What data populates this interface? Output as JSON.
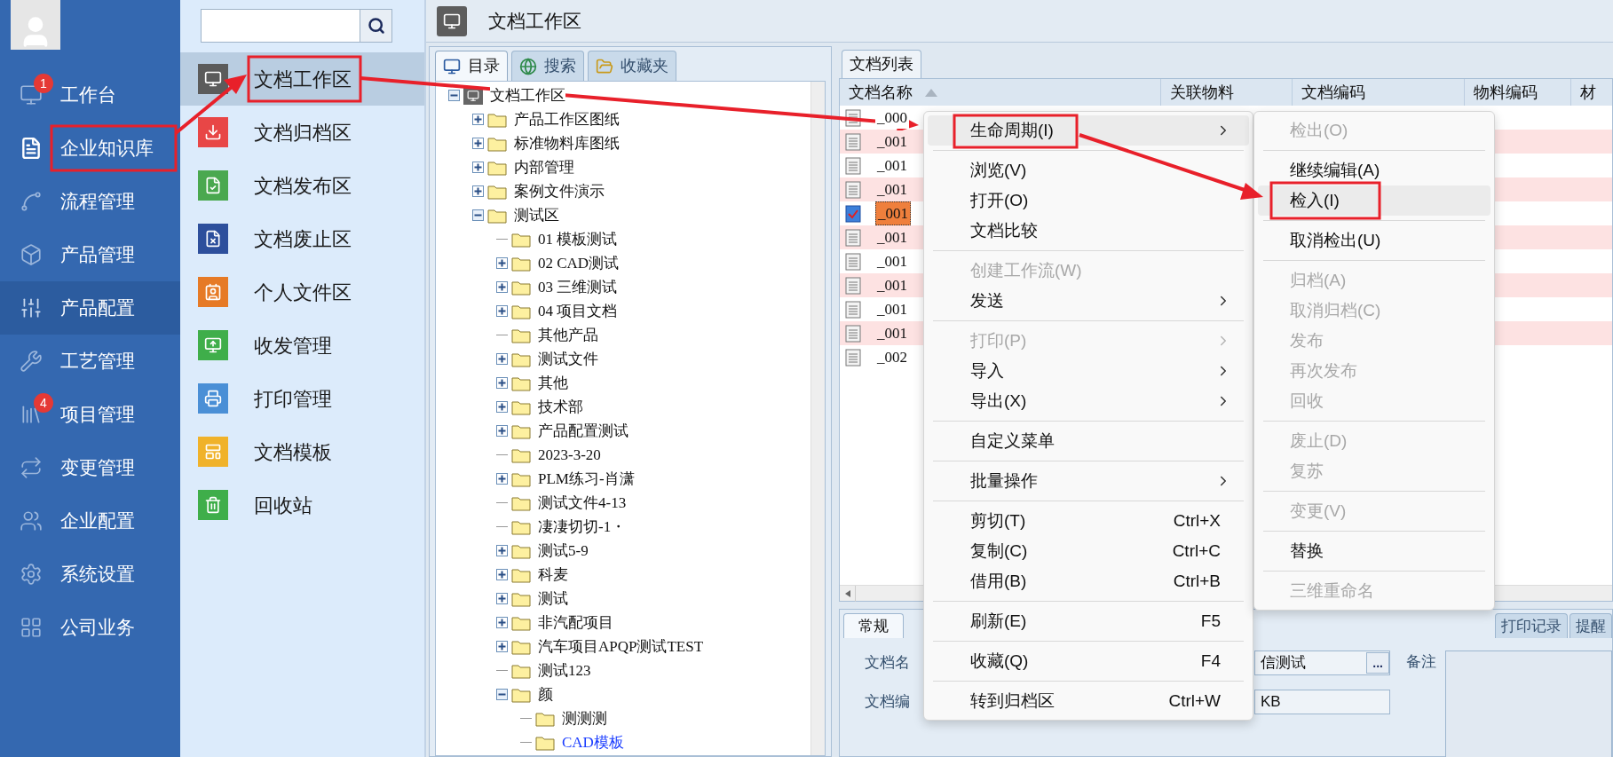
{
  "nav": {
    "items": [
      {
        "label": "工作台",
        "badge": "1",
        "selected": false,
        "hovered": false
      },
      {
        "label": "企业知识库",
        "selected": true,
        "hovered": false
      },
      {
        "label": "流程管理",
        "selected": false,
        "hovered": false
      },
      {
        "label": "产品管理",
        "selected": false,
        "hovered": false
      },
      {
        "label": "产品配置",
        "selected": false,
        "hovered": true
      },
      {
        "label": "工艺管理",
        "selected": false,
        "hovered": false
      },
      {
        "label": "项目管理",
        "badge": "4",
        "selected": false,
        "hovered": false
      },
      {
        "label": "变更管理",
        "selected": false,
        "hovered": false
      },
      {
        "label": "企业配置",
        "selected": false,
        "hovered": false
      },
      {
        "label": "系统设置",
        "selected": false,
        "hovered": false
      },
      {
        "label": "公司业务",
        "selected": false,
        "hovered": false
      }
    ]
  },
  "modules": {
    "items": [
      {
        "label": "文档工作区",
        "selected": true
      },
      {
        "label": "文档归档区",
        "selected": false
      },
      {
        "label": "文档发布区",
        "selected": false
      },
      {
        "label": "文档废止区",
        "selected": false
      },
      {
        "label": "个人文件区",
        "selected": false
      },
      {
        "label": "收发管理",
        "selected": false
      },
      {
        "label": "打印管理",
        "selected": false
      },
      {
        "label": "文档模板",
        "selected": false
      },
      {
        "label": "回收站",
        "selected": false
      }
    ]
  },
  "header": {
    "title": "文档工作区"
  },
  "tree_tabs": [
    {
      "label": "目录",
      "selected": true
    },
    {
      "label": "搜索",
      "selected": false
    },
    {
      "label": "收藏夹",
      "selected": false
    }
  ],
  "tree": {
    "label": "文档工作区",
    "expandable": true,
    "expanded": true,
    "selected": false,
    "children": [
      {
        "label": "产品工作区图纸",
        "expandable": true,
        "expanded": false,
        "selected": false
      },
      {
        "label": "标准物料库图纸",
        "expandable": true,
        "expanded": false,
        "selected": false
      },
      {
        "label": "内部管理",
        "expandable": true,
        "expanded": false,
        "selected": false
      },
      {
        "label": "案例文件演示",
        "expandable": true,
        "expanded": false,
        "selected": false
      },
      {
        "label": "测试区",
        "expandable": true,
        "expanded": true,
        "selected": false,
        "children": [
          {
            "label": "01 模板测试",
            "expandable": false,
            "selected": false
          },
          {
            "label": "02 CAD测试",
            "expandable": true,
            "expanded": false,
            "selected": false
          },
          {
            "label": "03 三维测试",
            "expandable": true,
            "expanded": false,
            "selected": false
          },
          {
            "label": "04 项目文档",
            "expandable": true,
            "expanded": false,
            "selected": false
          },
          {
            "label": "其他产品",
            "expandable": false,
            "selected": false
          },
          {
            "label": "测试文件",
            "expandable": true,
            "expanded": false,
            "selected": false
          },
          {
            "label": "其他",
            "expandable": true,
            "expanded": false,
            "selected": false
          },
          {
            "label": "技术部",
            "expandable": true,
            "expanded": false,
            "selected": false
          },
          {
            "label": "产品配置测试",
            "expandable": true,
            "expanded": false,
            "selected": false
          },
          {
            "label": "2023-3-20",
            "expandable": false,
            "selected": false
          },
          {
            "label": "PLM练习-肖潇",
            "expandable": true,
            "expanded": false,
            "selected": false
          },
          {
            "label": "测试文件4-13",
            "expandable": false,
            "selected": false
          },
          {
            "label": "凄凄切切-1・",
            "expandable": false,
            "selected": false
          },
          {
            "label": "测试5-9",
            "expandable": true,
            "expanded": false,
            "selected": false
          },
          {
            "label": "科麦",
            "expandable": true,
            "expanded": false,
            "selected": false
          },
          {
            "label": "测试",
            "expandable": true,
            "expanded": false,
            "selected": false
          },
          {
            "label": "非汽配项目",
            "expandable": true,
            "expanded": false,
            "selected": false
          },
          {
            "label": "汽车项目APQP测试TEST",
            "expandable": true,
            "expanded": false,
            "selected": false
          },
          {
            "label": "测试123",
            "expandable": false,
            "selected": false
          },
          {
            "label": "颜",
            "expandable": true,
            "expanded": true,
            "selected": false,
            "children": [
              {
                "label": "测测测",
                "expandable": false,
                "selected": false
              },
              {
                "label": "CAD模板",
                "expandable": false,
                "selected": true
              }
            ]
          }
        ]
      }
    ]
  },
  "list_tab": {
    "label": "文档列表",
    "selected": true
  },
  "table": {
    "columns": [
      "文档名称",
      "关联物料",
      "文档编码",
      "物料编码",
      "材"
    ],
    "rows": [
      {
        "name": "_000",
        "selected": false,
        "checked_out": false
      },
      {
        "name": "_001",
        "selected": false,
        "checked_out": false
      },
      {
        "name": "_001",
        "selected": false,
        "checked_out": false
      },
      {
        "name": "_001",
        "selected": false,
        "checked_out": false
      },
      {
        "name": "_001",
        "selected": true,
        "checked_out": true
      },
      {
        "name": "_001",
        "selected": false,
        "checked_out": false
      },
      {
        "name": "_001",
        "selected": false,
        "checked_out": false
      },
      {
        "name": "_001",
        "selected": false,
        "checked_out": false
      },
      {
        "name": "_001",
        "selected": false,
        "checked_out": false
      },
      {
        "name": "_001",
        "selected": false,
        "checked_out": false
      },
      {
        "name": "_002",
        "selected": false,
        "checked_out": false
      }
    ]
  },
  "detail": {
    "tabs": [
      {
        "label": "常规",
        "selected": true
      },
      {
        "label": "打印记录",
        "selected": false
      },
      {
        "label": "提醒",
        "selected": false
      }
    ],
    "fields": [
      {
        "label": "文档名",
        "value": "信测试",
        "browse": "..."
      },
      {
        "label": "文档编",
        "value": "KB"
      }
    ],
    "note_label": "备注"
  },
  "context_menu": {
    "items": [
      {
        "kind": "item",
        "label": "生命周期(I)",
        "disabled": false,
        "selected": true,
        "submenu": true
      },
      {
        "kind": "separator"
      },
      {
        "kind": "item",
        "label": "浏览(V)",
        "disabled": false,
        "selected": false,
        "submenu": false
      },
      {
        "kind": "item",
        "label": "打开(O)",
        "disabled": false,
        "selected": false,
        "submenu": false
      },
      {
        "kind": "item",
        "label": "文档比较",
        "disabled": false,
        "selected": false,
        "submenu": false
      },
      {
        "kind": "separator"
      },
      {
        "kind": "item",
        "label": "创建工作流(W)",
        "disabled": true,
        "selected": false,
        "submenu": false
      },
      {
        "kind": "item",
        "label": "发送",
        "disabled": false,
        "selected": false,
        "submenu": true
      },
      {
        "kind": "separator"
      },
      {
        "kind": "item",
        "label": "打印(P)",
        "disabled": true,
        "selected": false,
        "submenu": true
      },
      {
        "kind": "item",
        "label": "导入",
        "disabled": false,
        "selected": false,
        "submenu": true
      },
      {
        "kind": "item",
        "label": "导出(X)",
        "disabled": false,
        "selected": false,
        "submenu": true
      },
      {
        "kind": "separator"
      },
      {
        "kind": "item",
        "label": "自定义菜单",
        "disabled": false,
        "selected": false,
        "submenu": false
      },
      {
        "kind": "separator"
      },
      {
        "kind": "item",
        "label": "批量操作",
        "disabled": false,
        "selected": false,
        "submenu": true
      },
      {
        "kind": "separator"
      },
      {
        "kind": "item",
        "label": "剪切(T)",
        "shortcut": "Ctrl+X",
        "disabled": false,
        "selected": false,
        "submenu": false
      },
      {
        "kind": "item",
        "label": "复制(C)",
        "shortcut": "Ctrl+C",
        "disabled": false,
        "selected": false,
        "submenu": false
      },
      {
        "kind": "item",
        "label": "借用(B)",
        "shortcut": "Ctrl+B",
        "disabled": false,
        "selected": false,
        "submenu": false
      },
      {
        "kind": "separator"
      },
      {
        "kind": "item",
        "label": "刷新(E)",
        "shortcut": "F5",
        "disabled": false,
        "selected": false,
        "submenu": false
      },
      {
        "kind": "separator"
      },
      {
        "kind": "item",
        "label": "收藏(Q)",
        "shortcut": "F4",
        "disabled": false,
        "selected": false,
        "submenu": false
      },
      {
        "kind": "separator"
      },
      {
        "kind": "item",
        "label": "转到归档区",
        "shortcut": "Ctrl+W",
        "disabled": false,
        "selected": false,
        "submenu": false
      }
    ]
  },
  "submenu": {
    "items": [
      {
        "kind": "item",
        "label": "检出(O)",
        "disabled": true,
        "selected": false
      },
      {
        "kind": "separator"
      },
      {
        "kind": "item",
        "label": "继续编辑(A)",
        "disabled": false,
        "selected": false
      },
      {
        "kind": "item",
        "label": "检入(I)",
        "disabled": false,
        "selected": true
      },
      {
        "kind": "separator"
      },
      {
        "kind": "item",
        "label": "取消检出(U)",
        "disabled": false,
        "selected": false
      },
      {
        "kind": "separator"
      },
      {
        "kind": "item",
        "label": "归档(A)",
        "disabled": true,
        "selected": false
      },
      {
        "kind": "item",
        "label": "取消归档(C)",
        "disabled": true,
        "selected": false
      },
      {
        "kind": "item",
        "label": "发布",
        "disabled": true,
        "selected": false
      },
      {
        "kind": "item",
        "label": "再次发布",
        "disabled": true,
        "selected": false
      },
      {
        "kind": "item",
        "label": "回收",
        "disabled": true,
        "selected": false
      },
      {
        "kind": "separator"
      },
      {
        "kind": "item",
        "label": "废止(D)",
        "disabled": true,
        "selected": false
      },
      {
        "kind": "item",
        "label": "复苏",
        "disabled": true,
        "selected": false
      },
      {
        "kind": "separator"
      },
      {
        "kind": "item",
        "label": "变更(V)",
        "disabled": true,
        "selected": false
      },
      {
        "kind": "separator"
      },
      {
        "kind": "item",
        "label": "替换",
        "disabled": false,
        "selected": false
      },
      {
        "kind": "separator"
      },
      {
        "kind": "item",
        "label": "三维重命名",
        "disabled": true,
        "selected": false
      }
    ]
  }
}
